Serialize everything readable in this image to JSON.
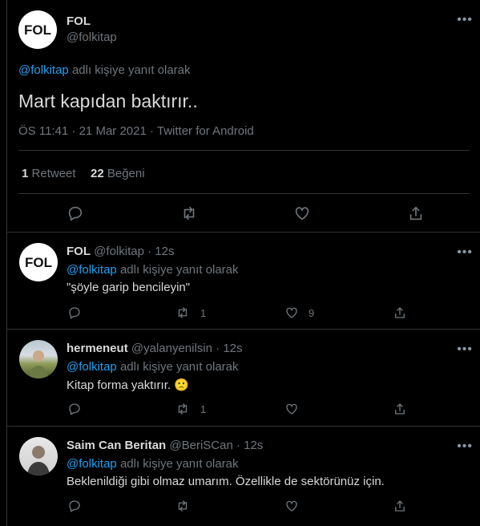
{
  "main_tweet": {
    "display_name": "FOL",
    "handle": "@folkitap",
    "reply_to_handle": "@folkitap",
    "reply_to_suffix": "adlı kişiye yanıt olarak",
    "text": "Mart kapıdan baktırır..",
    "meta": "ÖS 11:41 · 21 Mar 2021 · Twitter for Android",
    "retweet_count": "1",
    "retweet_label": "Retweet",
    "like_count": "22",
    "like_label": "Beğeni",
    "more_glyph": "•••"
  },
  "avatar_logo_text": "FOL",
  "replies": [
    {
      "display_name": "FOL",
      "handle": "@folkitap",
      "time": "· 12s",
      "reply_to_handle": "@folkitap",
      "reply_to_suffix": "adlı kişiye yanıt olarak",
      "text": "\"şöyle garip bencileyin\"",
      "retweets": "1",
      "likes": "9"
    },
    {
      "display_name": "hermeneut",
      "handle": "@yalanyenilsin",
      "time": "· 12s",
      "reply_to_handle": "@folkitap",
      "reply_to_suffix": "adlı kişiye yanıt olarak",
      "text": "Kitap forma yaktırır.",
      "emoji": "🙁",
      "retweets": "1",
      "likes": ""
    },
    {
      "display_name": "Saim Can Beritan",
      "handle": "@BeriSCan",
      "time": "· 12s",
      "reply_to_handle": "@folkitap",
      "reply_to_suffix": "adlı kişiye yanıt olarak",
      "text": "Beklenildiği gibi olmaz umarım. Özellikle de sektörünüz için.",
      "retweets": "",
      "likes": ""
    }
  ],
  "icons": [
    "reply-icon",
    "retweet-icon",
    "like-icon",
    "share-icon",
    "more-icon"
  ],
  "colors": {
    "background": "#000000",
    "link": "#1da1f2",
    "muted": "#6e767d",
    "text": "#d9d9d9",
    "border": "#2f3336"
  }
}
